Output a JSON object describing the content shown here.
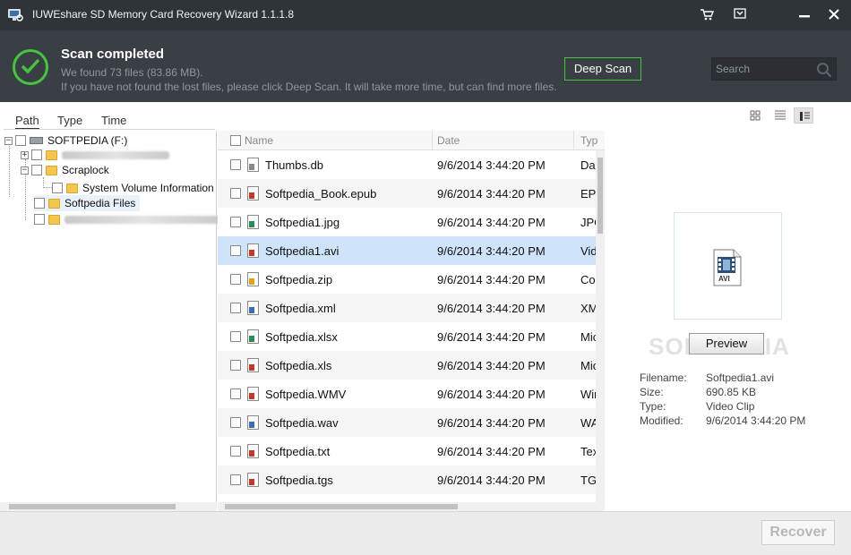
{
  "window": {
    "title": "IUWEshare SD Memory Card Recovery Wizard 1.1.1.8",
    "controls": [
      "cart-icon",
      "dropdown-icon",
      "minimize-icon",
      "close-icon"
    ]
  },
  "status": {
    "title": "Scan completed",
    "found": "We found 73 files (83.86 MB).",
    "hint": "If you have not found the lost files, please click Deep Scan. It will take more time, but can find more files.",
    "deep_scan_label": "Deep Scan",
    "accent": "#46c43d"
  },
  "search": {
    "placeholder": "Search"
  },
  "tabs": [
    {
      "label": "Path",
      "active": true
    },
    {
      "label": "Type",
      "active": false
    },
    {
      "label": "Time",
      "active": false
    }
  ],
  "view_modes": [
    "grid-view-icon",
    "list-view-icon",
    "detail-view-icon"
  ],
  "tree": {
    "root": "SOFTPEDIA (F:)",
    "items": [
      {
        "label": "",
        "blurred": true
      },
      {
        "label": "Scraplock"
      },
      {
        "label": "System Volume Information"
      },
      {
        "label": "Softpedia Files"
      },
      {
        "label": "",
        "blurred": true
      }
    ]
  },
  "filelist": {
    "columns": [
      "Name",
      "Date",
      "Type"
    ],
    "rows": [
      {
        "name": "Thumbs.db",
        "date": "9/6/2014 3:44:20 PM",
        "type": "Data",
        "icon_color": "#8a8a8a"
      },
      {
        "name": "Softpedia_Book.epub",
        "date": "9/6/2014 3:44:20 PM",
        "type": "EPUB",
        "icon_color": "#c0392b"
      },
      {
        "name": "Softpedia1.jpg",
        "date": "9/6/2014 3:44:20 PM",
        "type": "JPG",
        "icon_color": "#2e8b57"
      },
      {
        "name": "Softpedia1.avi",
        "date": "9/6/2014 3:44:20 PM",
        "type": "Video",
        "icon_color": "#c0392b",
        "selected": true
      },
      {
        "name": "Softpedia.zip",
        "date": "9/6/2014 3:44:20 PM",
        "type": "Compressed",
        "icon_color": "#e0a020"
      },
      {
        "name": "Softpedia.xml",
        "date": "9/6/2014 3:44:20 PM",
        "type": "XML",
        "icon_color": "#3b6db3"
      },
      {
        "name": "Softpedia.xlsx",
        "date": "9/6/2014 3:44:20 PM",
        "type": "Microsoft",
        "icon_color": "#2e8b57"
      },
      {
        "name": "Softpedia.xls",
        "date": "9/6/2014 3:44:20 PM",
        "type": "Microsoft",
        "icon_color": "#c0392b"
      },
      {
        "name": "Softpedia.WMV",
        "date": "9/6/2014 3:44:20 PM",
        "type": "Windows",
        "icon_color": "#c0392b"
      },
      {
        "name": "Softpedia.wav",
        "date": "9/6/2014 3:44:20 PM",
        "type": "WAV",
        "icon_color": "#3b6db3"
      },
      {
        "name": "Softpedia.txt",
        "date": "9/6/2014 3:44:20 PM",
        "type": "Text",
        "icon_color": "#c0392b"
      },
      {
        "name": "Softpedia.tgs",
        "date": "9/6/2014 3:44:20 PM",
        "type": "TGS",
        "icon_color": "#c0392b"
      }
    ]
  },
  "preview": {
    "thumb_caption": "AVI",
    "button_label": "Preview",
    "watermark": "SOFTPEDIA",
    "fields": [
      {
        "key": "Filename:",
        "value": "Softpedia1.avi"
      },
      {
        "key": "Size:",
        "value": "690.85 KB"
      },
      {
        "key": "Type:",
        "value": "Video Clip"
      },
      {
        "key": "Modified:",
        "value": "9/6/2014 3:44:20 PM"
      }
    ]
  },
  "footer": {
    "recover_label": "Recover"
  }
}
